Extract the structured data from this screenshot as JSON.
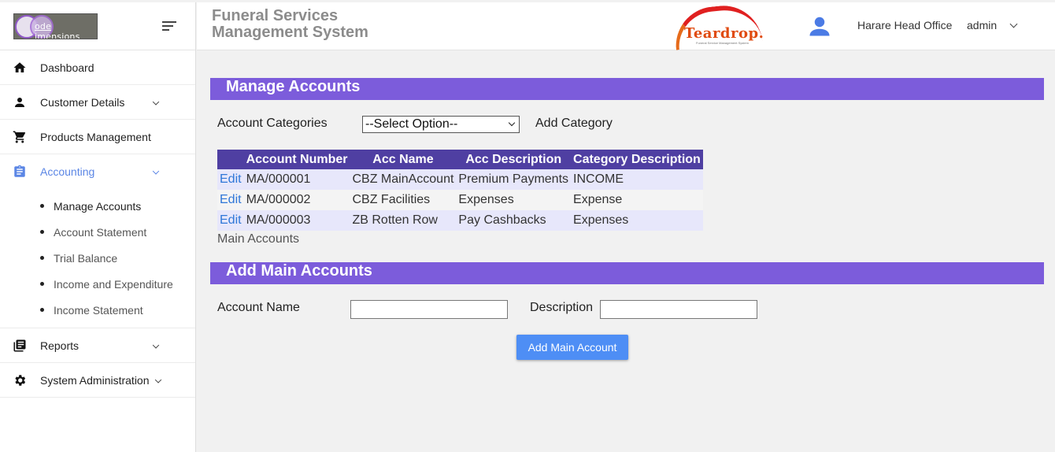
{
  "logo": {
    "text": "ode  imensions"
  },
  "header": {
    "app_title_line1": "Funeral Services",
    "app_title_line2": "Management System",
    "brand_name": "Teardrop.",
    "brand_tagline": "Funeral Service Management System",
    "office": "Harare Head Office",
    "user": "admin"
  },
  "sidebar": {
    "items": [
      {
        "label": "Dashboard",
        "icon": "home-icon"
      },
      {
        "label": "Customer Details",
        "icon": "person-icon"
      },
      {
        "label": "Products Management",
        "icon": "cart-icon"
      },
      {
        "label": "Accounting",
        "icon": "clipboard-icon"
      },
      {
        "label": "Reports",
        "icon": "document-icon"
      },
      {
        "label": "System Administration",
        "icon": "gear-icon"
      }
    ],
    "accounting_sub": [
      "Manage Accounts",
      "Account Statement",
      "Trial Balance",
      "Income and Expenditure",
      "Income Statement"
    ]
  },
  "manage": {
    "title": "Manage Accounts",
    "categories_label": "Account Categories",
    "select_value": "--Select Option--",
    "add_category": "Add Category",
    "columns": [
      "Account Number",
      "Acc Name",
      "Acc Description",
      "Category Description"
    ],
    "rows": [
      {
        "edit": "Edit",
        "number": "MA/000001",
        "name": "CBZ MainAccount",
        "description": "Premium Payments",
        "category": "INCOME"
      },
      {
        "edit": "Edit",
        "number": "MA/000002",
        "name": "CBZ Facilities",
        "description": "Expenses",
        "category": "Expense"
      },
      {
        "edit": "Edit",
        "number": "MA/000003",
        "name": "ZB Rotten Row",
        "description": "Pay Cashbacks",
        "category": "Expenses"
      }
    ],
    "caption": "Main Accounts"
  },
  "add": {
    "title": "Add Main Accounts",
    "account_name_label": "Account Name",
    "description_label": "Description",
    "account_name_value": "",
    "description_value": "",
    "button": "Add Main Account"
  },
  "colors": {
    "band": "#7c5cdb",
    "table_header": "#4f3fa2",
    "link": "#2f77d8",
    "button": "#4e8ef5",
    "active_nav": "#5b86e5"
  }
}
